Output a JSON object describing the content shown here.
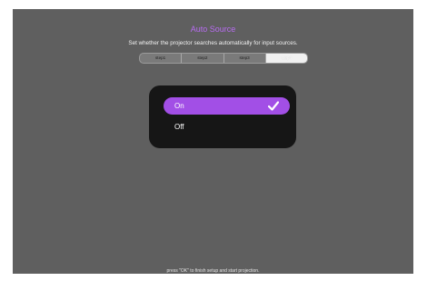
{
  "header": {
    "title": "Auto Source",
    "subtitle": "Set whether the projector searches automatically for input sources."
  },
  "wizard": {
    "steps": [
      "step1",
      "step2",
      "step3",
      "step4"
    ],
    "active_step": "step4"
  },
  "options": {
    "items": [
      {
        "label": "On",
        "selected": true
      },
      {
        "label": "Off",
        "selected": false
      }
    ],
    "check_icon": "checkmark-icon"
  },
  "footer": {
    "hint": "press \"OK\" to finish setup and start projection."
  },
  "colors": {
    "accent": "#a24fe6",
    "title": "#b76cf0",
    "background": "#5f5f5f",
    "panel": "#161616"
  }
}
